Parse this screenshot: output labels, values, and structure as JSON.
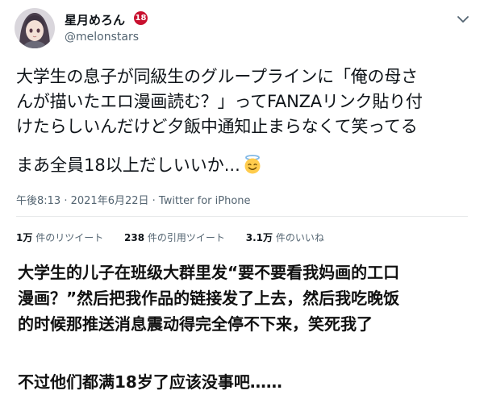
{
  "author": {
    "name": "星月めろん",
    "age_badge": "18",
    "handle": "@melonstars"
  },
  "tweet": {
    "lines": [
      "大学生の息子が同級生のグループラインに「俺の母さ",
      "んが描いたエロ漫画読む？」ってFANZAリンク貼り付",
      "けたらしいんだけど夕飯中通知止まらなくて笑ってる"
    ],
    "last_line": "まあ全員18以上だしいいか...",
    "emoji": "smiling-face-with-halo"
  },
  "meta": {
    "time": "午後8:13",
    "date": "2021年6月22日",
    "source": "Twitter for iPhone",
    "separator": " · "
  },
  "stats": {
    "retweets_count": "1万",
    "retweets_label": "件のリツイート",
    "quotes_count": "238",
    "quotes_label": "件の引用ツイート",
    "likes_count": "3.1万",
    "likes_label": "件のいいね"
  },
  "caption": {
    "lines": [
      "大学生的儿子在班级大群里发“要不要看我妈画的工口",
      "漫画？”然后把我作品的链接发了上去，然后我吃晚饭",
      "的时候那推送消息震动得完全停不下来，笑死我了"
    ],
    "last_line": "不过他们都满18岁了应该没事吧……"
  },
  "colors": {
    "text": "#0f1419",
    "muted": "#536471",
    "divider": "#e7e9ea",
    "badge": "#c8102e"
  }
}
